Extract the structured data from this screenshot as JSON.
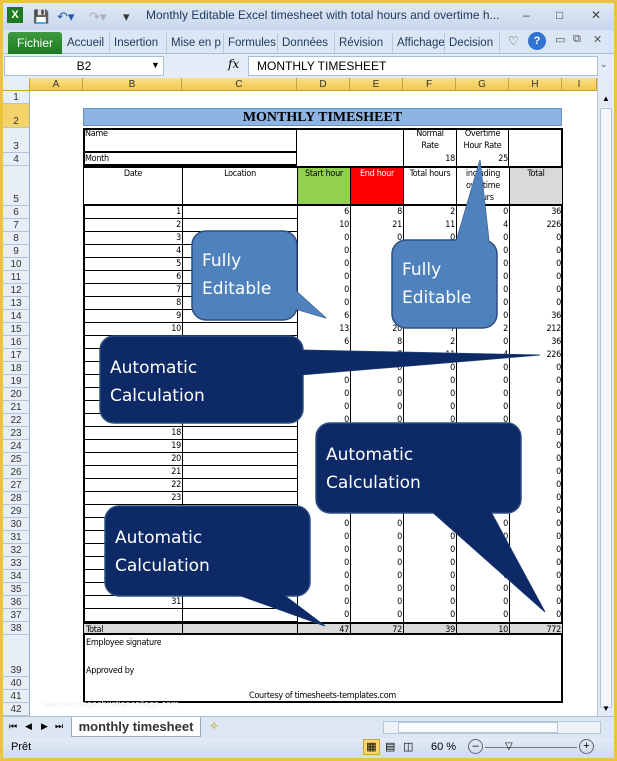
{
  "window": {
    "title": "Monthly Editable Excel timesheet with total hours and overtime h...",
    "app_icon": "excel-icon",
    "min": "–",
    "max": "□",
    "close": "✕"
  },
  "ribbon": {
    "file": "Fichier",
    "tabs": [
      "Accueil",
      "Insertion",
      "Mise en p",
      "Formules",
      "Données",
      "Révision",
      "Affichage",
      "Decision"
    ],
    "help": "?"
  },
  "formula_bar": {
    "name_box": "B2",
    "fx": "fx",
    "value": "MONTHLY TIMESHEET"
  },
  "columns": [
    "A",
    "B",
    "C",
    "D",
    "E",
    "F",
    "G",
    "H",
    "I"
  ],
  "rows": [
    "1",
    "2",
    "3",
    "4",
    "5",
    "6",
    "7",
    "8",
    "9",
    "10",
    "11",
    "12",
    "13",
    "14",
    "15",
    "16",
    "17",
    "18",
    "19",
    "20",
    "21",
    "22",
    "23",
    "24",
    "25",
    "26",
    "27",
    "28",
    "29",
    "30",
    "31",
    "32",
    "33",
    "34",
    "35",
    "36",
    "37",
    "38",
    "39",
    "40",
    "41",
    "42"
  ],
  "sheet": {
    "title": "MONTHLY TIMESHEET",
    "name_label": "Name",
    "month_label": "Month",
    "normal_rate_label": "Normal Rate",
    "normal_rate": "18",
    "overtime_rate_label": "Overtime Hour Rate",
    "overtime_rate": "25",
    "headers": {
      "date": "Date",
      "location": "Location",
      "start": "Start hour",
      "end": "End hour",
      "total_hours": "Total hours",
      "overtime": "including overtime hours",
      "total": "Total"
    },
    "header_colors": {
      "start": "#92d050",
      "end": "#ff0000",
      "total": "#d9d9d9",
      "title": "#8db4e2"
    },
    "data": [
      [
        "1",
        "",
        "6",
        "8",
        "2",
        "0",
        "36"
      ],
      [
        "2",
        "",
        "10",
        "21",
        "11",
        "4",
        "226"
      ],
      [
        "3",
        "",
        "0",
        "0",
        "0",
        "0",
        "0"
      ],
      [
        "4",
        "",
        "0",
        "0",
        "0",
        "0",
        "0"
      ],
      [
        "5",
        "",
        "0",
        "0",
        "0",
        "0",
        "0"
      ],
      [
        "6",
        "",
        "0",
        "0",
        "0",
        "0",
        "0"
      ],
      [
        "7",
        "",
        "0",
        "0",
        "0",
        "0",
        "0"
      ],
      [
        "8",
        "",
        "0",
        "0",
        "0",
        "0",
        "0"
      ],
      [
        "9",
        "",
        "6",
        "8",
        "2",
        "0",
        "36"
      ],
      [
        "10",
        "",
        "13",
        "20",
        "7",
        "2",
        "212"
      ],
      [
        "11",
        "",
        "6",
        "8",
        "2",
        "0",
        "36"
      ],
      [
        "12",
        "",
        "6",
        "7",
        "11",
        "4",
        "226"
      ],
      [
        "13",
        "",
        "0",
        "0",
        "0",
        "0",
        "0"
      ],
      [
        "14",
        "",
        "0",
        "0",
        "0",
        "0",
        "0"
      ],
      [
        "15",
        "",
        "0",
        "0",
        "0",
        "0",
        "0"
      ],
      [
        "16",
        "",
        "0",
        "0",
        "0",
        "0",
        "0"
      ],
      [
        "17",
        "",
        "0",
        "0",
        "0",
        "0",
        "0"
      ],
      [
        "18",
        "",
        "0",
        "0",
        "0",
        "0",
        "0"
      ],
      [
        "19",
        "",
        "0",
        "0",
        "0",
        "0",
        "0"
      ],
      [
        "20",
        "",
        "0",
        "0",
        "0",
        "0",
        "0"
      ],
      [
        "21",
        "",
        "0",
        "0",
        "0",
        "0",
        "0"
      ],
      [
        "22",
        "",
        "0",
        "0",
        "0",
        "0",
        "0"
      ],
      [
        "23",
        "",
        "0",
        "0",
        "0",
        "0",
        "0"
      ],
      [
        "24",
        "",
        "0",
        "0",
        "0",
        "0",
        "0"
      ],
      [
        "25",
        "",
        "0",
        "0",
        "0",
        "0",
        "0"
      ],
      [
        "26",
        "",
        "0",
        "0",
        "0",
        "0",
        "0"
      ],
      [
        "27",
        "",
        "0",
        "0",
        "0",
        "0",
        "0"
      ],
      [
        "28",
        "",
        "0",
        "0",
        "0",
        "0",
        "0"
      ],
      [
        "29",
        "",
        "0",
        "0",
        "0",
        "0",
        "0"
      ],
      [
        "30",
        "",
        "0",
        "0",
        "0",
        "0",
        "0"
      ],
      [
        "31",
        "",
        "0",
        "0",
        "0",
        "0",
        "0"
      ],
      [
        "",
        "",
        "0",
        "0",
        "0",
        "0",
        "0"
      ]
    ],
    "total_row": [
      "Total",
      "",
      "47",
      "72",
      "39",
      "10",
      "772"
    ],
    "employee_signature": "Employee signature",
    "approved_by": "Approved by",
    "courtesy": "Courtesy of timesheets-templates.com"
  },
  "callouts": [
    {
      "line1": "Fully",
      "line2": "Editable",
      "color": "#4f81bd"
    },
    {
      "line1": "Fully",
      "line2": "Editable",
      "color": "#4f81bd"
    },
    {
      "line1": "Automatic",
      "line2": "Calculation",
      "color": "#0e2a66"
    },
    {
      "line1": "Automatic",
      "line2": "Calculation",
      "color": "#0e2a66"
    },
    {
      "line1": "Automatic",
      "line2": "Calculation",
      "color": "#0e2a66"
    }
  ],
  "sheet_tabs": {
    "active": "monthly timesheet",
    "nav": [
      "⏮",
      "◀",
      "▶",
      "⏭"
    ]
  },
  "status": {
    "ready": "Prêt",
    "zoom": "60 %"
  },
  "watermark": "www.heritagechristiancollege.com"
}
